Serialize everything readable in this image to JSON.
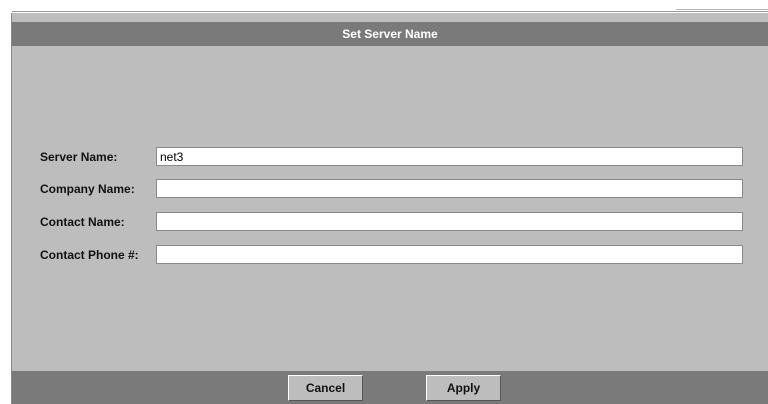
{
  "dialog": {
    "title": "Set Server Name"
  },
  "form": {
    "fields": [
      {
        "label": "Server Name:",
        "value": "net3"
      },
      {
        "label": "Company Name:",
        "value": ""
      },
      {
        "label": "Contact Name:",
        "value": ""
      },
      {
        "label": "Contact Phone #:",
        "value": ""
      }
    ]
  },
  "buttons": {
    "cancel_label": "Cancel",
    "apply_label": "Apply"
  },
  "colors": {
    "dialog_background": "#bdbdbd",
    "title_bar": "#7a7a7a",
    "title_text": "#ffffff"
  }
}
